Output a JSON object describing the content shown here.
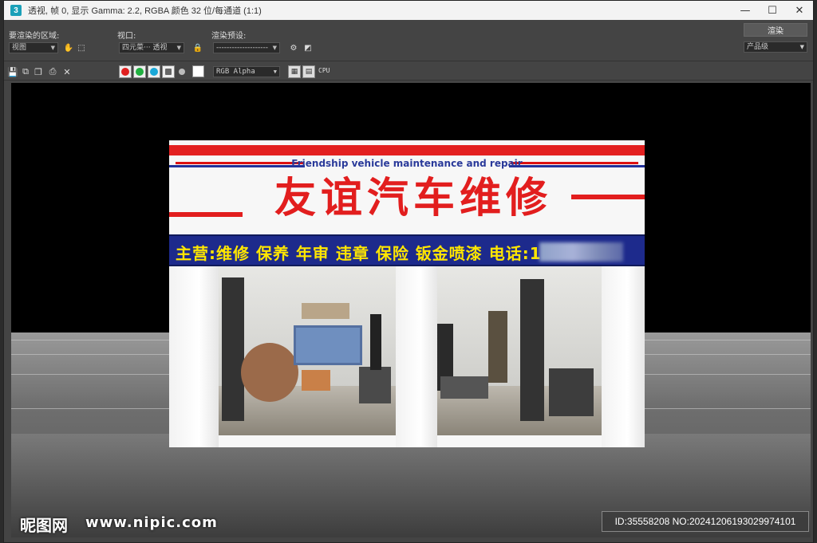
{
  "window": {
    "title": "透视, 帧 0, 显示 Gamma: 2.2, RGBA 颜色 32 位/每通道 (1:1)",
    "app_icon": "3",
    "controls": [
      "—",
      "☐",
      "✕"
    ]
  },
  "toolbar1": {
    "area_label": "要渲染的区域:",
    "area_value": "视图",
    "viewport_label": "视口:",
    "viewport_value": "四元菜··· 透视",
    "preset_label": "渲染预设:",
    "preset_value": "--------------------",
    "render_button": "渲染",
    "quality_value": "产品级"
  },
  "toolbar2": {
    "channel_value": "RGB Alpha",
    "cpu_label": "CPU",
    "colors": {
      "red": "#e02020",
      "green": "#20b040",
      "blue": "#1aa8d8"
    }
  },
  "scene": {
    "english_name": "Friendship vehicle maintenance and repair",
    "chinese_name": "友谊汽车维修",
    "services": "主营:维修 保养 年审 违章 保险 钣金喷漆  电话:1"
  },
  "watermark": {
    "logo": "昵图网",
    "site": "www.nipic.com",
    "id_text": "ID:35558208 NO:20241206193029974101"
  }
}
